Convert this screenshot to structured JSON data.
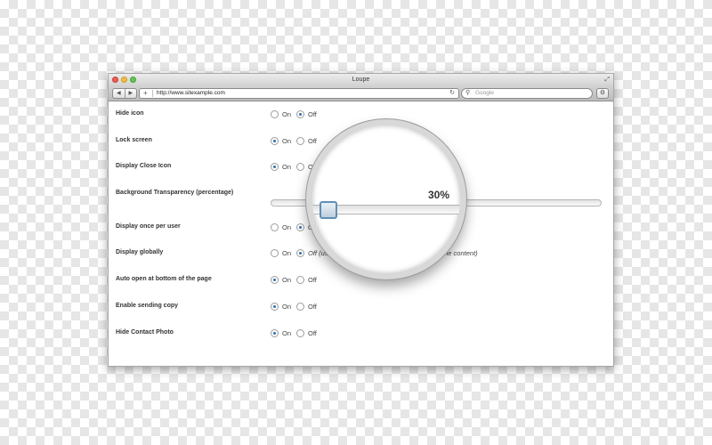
{
  "window": {
    "title": "Loupe",
    "traffic_lights": [
      "close",
      "minimize",
      "zoom"
    ]
  },
  "toolbar": {
    "back_icon": "back-arrow-icon",
    "forward_icon": "forward-arrow-icon",
    "add_symbol": "+",
    "url": "http://www.sitexample.com",
    "reload_symbol": "↻",
    "search_placeholder": "Google",
    "search_symbol": "⚲",
    "settings_symbol": "⚙"
  },
  "settings": [
    {
      "label": "Hide icon",
      "on": "On",
      "off": "Off",
      "selected": "off"
    },
    {
      "label": "Lock screen",
      "on": "On",
      "off": "Off",
      "selected": "on"
    },
    {
      "label": "Display Close Icon",
      "on": "On",
      "off": "Off",
      "selected": "on"
    },
    {
      "label": "Background Transparency (percentage)",
      "type": "slider",
      "value": 30
    },
    {
      "label": "Display once per user",
      "on": "On",
      "off": "Off",
      "selected": "on"
    },
    {
      "label": "Display globally",
      "on": "On",
      "off": "Off (use",
      "hint_end": "de in the content)",
      "selected": "off"
    },
    {
      "label": "Auto open at bottom of the page",
      "on": "On",
      "off": "Off",
      "selected": "on"
    },
    {
      "label": "Enable sending copy",
      "on": "On",
      "off": "Off",
      "selected": "on"
    },
    {
      "label": "Hide Contact Photo",
      "on": "On",
      "off": "Off",
      "selected": "on"
    }
  ],
  "loupe": {
    "value_text": "30%"
  },
  "colors": {
    "radio_selected": "#2c6fb2",
    "slider_handle_border": "#5f8fb7"
  }
}
